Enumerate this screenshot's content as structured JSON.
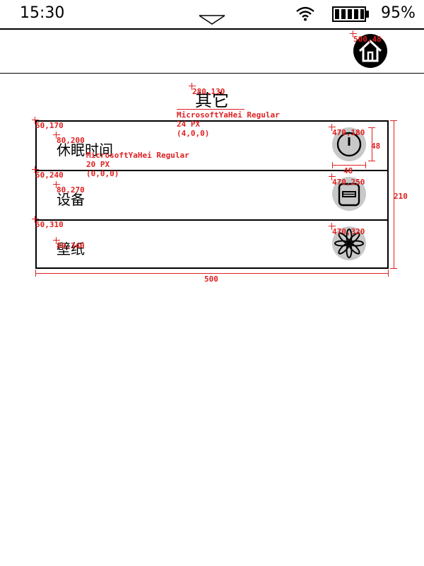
{
  "status_bar": {
    "time": "15:30",
    "battery_percent": "95%",
    "battery_level": 0.95,
    "icons": [
      "pulldown-arrow-icon",
      "wifi-icon",
      "battery-icon"
    ]
  },
  "header": {
    "home_icon": "home-icon"
  },
  "page": {
    "title": "其它"
  },
  "menu": {
    "items": [
      {
        "label": "休眠时间",
        "icon": "power-icon"
      },
      {
        "label": "设备",
        "icon": "device-icon"
      },
      {
        "label": "壁纸",
        "icon": "flower-icon"
      }
    ]
  },
  "annotations": {
    "home": "500,48",
    "title_pos": "280,130",
    "title_font": "MicrosoftYaHei Regular",
    "title_size": "24 PX",
    "title_color": "(4,0,0)",
    "row1_pos": "50,170",
    "row1_label_pos": "80,200",
    "label_font": "MicrosoftYaHei Regular",
    "label_size": "20 PX",
    "label_color": "(0,0,0)",
    "row1_icon_pos": "470,180",
    "icon_height": "48",
    "icon_width": "48",
    "row2_pos": "50,240",
    "row2_label_pos": "80,270",
    "row2_icon_pos": "470,250",
    "row3_pos": "50,310",
    "row3_label_pos": "80,340",
    "row3_icon_pos": "470,320",
    "list_height": "210",
    "list_width": "500"
  },
  "colors": {
    "annotation": "#e02020",
    "icon_bg": "#c8c8c8"
  }
}
